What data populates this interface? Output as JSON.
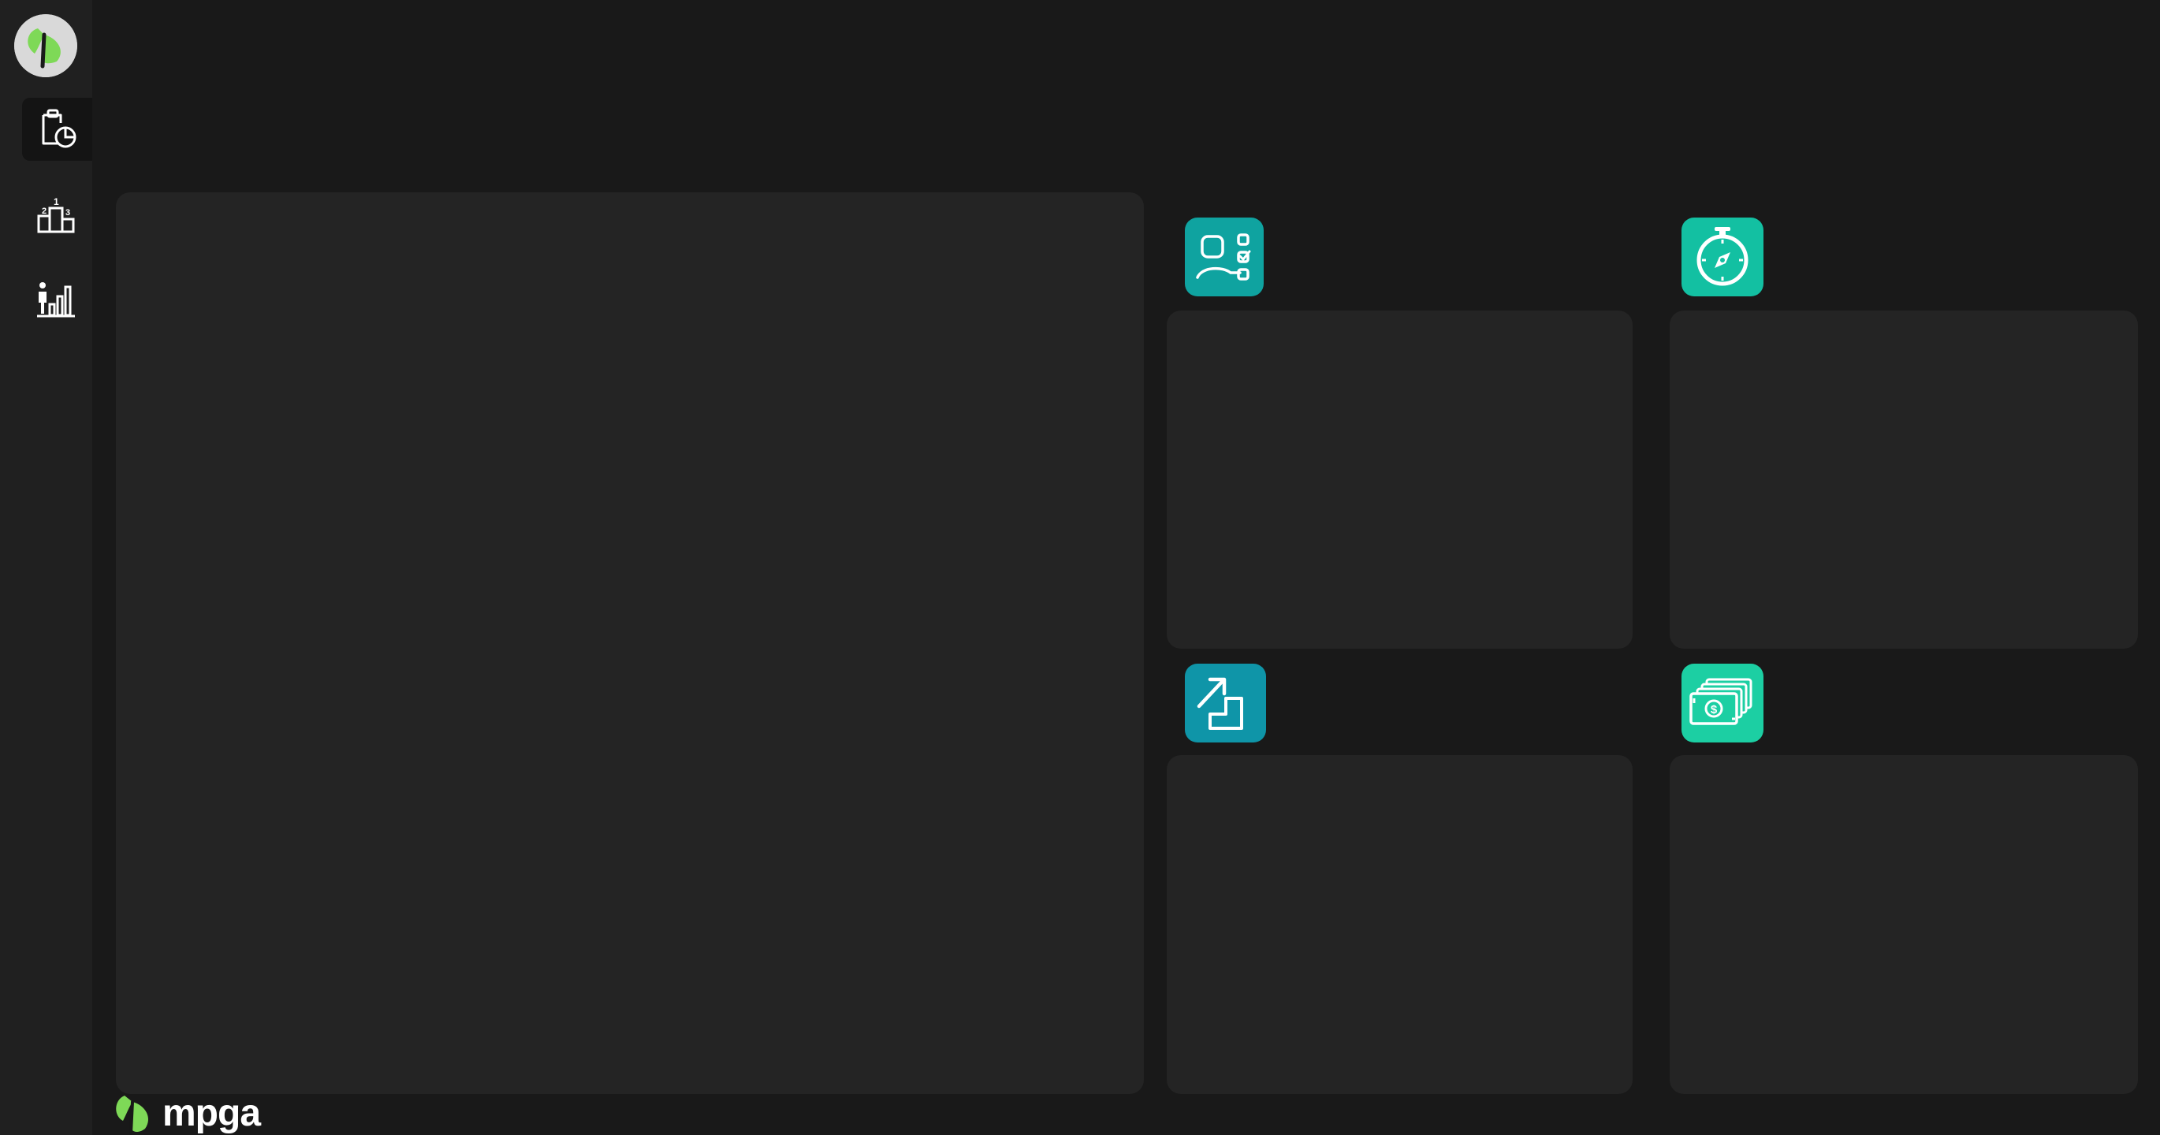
{
  "brand": {
    "name": "mpga",
    "logo_icon": "green-leaf-logo-icon"
  },
  "colors": {
    "sidebar_bg": "#202020",
    "page_bg": "#191919",
    "panel_bg": "#242424",
    "active_nav_bg": "#141414",
    "logo_green": "#7ed957",
    "tile_user_checklist": "#0fa3a0",
    "tile_stopwatch": "#13c0a2",
    "tile_steps_growth": "#0f95a8",
    "tile_money": "#1ccfa3"
  },
  "sidebar": {
    "items": [
      {
        "icon": "report-chart-icon",
        "active": true
      },
      {
        "icon": "podium-ranking-icon",
        "active": false
      },
      {
        "icon": "player-stats-icon",
        "active": false
      }
    ]
  },
  "cards": [
    {
      "icon": "user-checklist-icon"
    },
    {
      "icon": "stopwatch-icon"
    },
    {
      "icon": "stairs-growth-icon"
    },
    {
      "icon": "money-stack-icon"
    }
  ]
}
